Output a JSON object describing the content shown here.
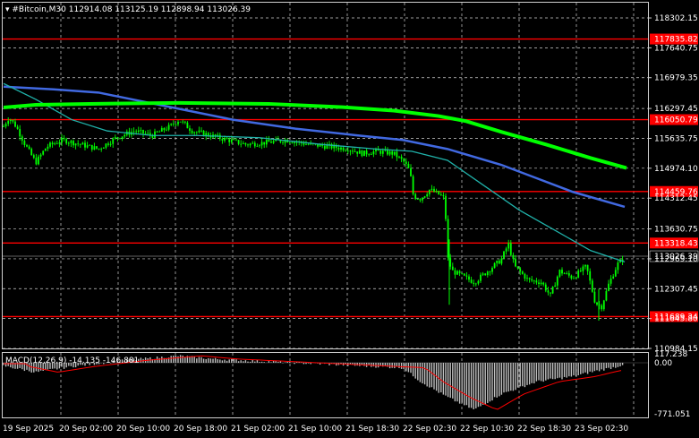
{
  "header": {
    "symbol": "#Bitcoin,M30",
    "ohlc": "112914.08 113125.19 112898.94 113026.39"
  },
  "price_axis": {
    "labels": [
      "118302.15",
      "117640.75",
      "116979.35",
      "116297.45",
      "115635.75",
      "114974.10",
      "114312.45",
      "113630.75",
      "112969.10",
      "112307.45",
      "111645.80",
      "110984.15"
    ],
    "current_price": "113026.39",
    "current_price_color": "#ffffff"
  },
  "horizontal_lines": [
    {
      "value": "117835.82",
      "color": "#ff0000"
    },
    {
      "value": "116050.79",
      "color": "#ff0000"
    },
    {
      "value": "114459.76",
      "color": "#ff0000"
    },
    {
      "value": "113318.43",
      "color": "#ff0000"
    },
    {
      "value": "111689.34",
      "color": "#ff0000"
    }
  ],
  "time_axis": {
    "labels": [
      "19 Sep 2025",
      "20 Sep 02:00",
      "20 Sep 10:00",
      "20 Sep 18:00",
      "21 Sep 02:00",
      "21 Sep 10:00",
      "21 Sep 18:30",
      "22 Sep 02:30",
      "22 Sep 10:30",
      "22 Sep 18:30",
      "23 Sep 02:30"
    ]
  },
  "macd": {
    "label": "MACD(12,26,9) -14.135 -146.881",
    "axis_labels": [
      "117.238",
      "0.00",
      "-771.051"
    ]
  },
  "colors": {
    "background": "#000000",
    "grid": "#d0d0d0",
    "candle": "#00ff00",
    "ma_slow": "#00ff00",
    "ma_mid": "#4169e1",
    "ma_fast": "#20b2aa",
    "level_line": "#ff0000",
    "macd_hist": "#c0c0c0",
    "macd_signal": "#ff0000"
  },
  "chart_data": {
    "type": "line",
    "title": "#Bitcoin,M30",
    "x": [
      "19 Sep 2025",
      "20 Sep 02:00",
      "20 Sep 10:00",
      "20 Sep 18:00",
      "21 Sep 02:00",
      "21 Sep 10:00",
      "21 Sep 18:30",
      "22 Sep 02:30",
      "22 Sep 10:30",
      "22 Sep 18:30",
      "23 Sep 02:30"
    ],
    "series": [
      {
        "values": [
          116050,
          115900,
          115640,
          115980,
          115640,
          115520,
          115250,
          113200,
          112900,
          112600,
          113026
        ]
      },
      {
        "values": [
          116297,
          116270,
          116297,
          116297,
          116200,
          116100,
          115950,
          115700,
          115300,
          114900,
          114974
        ]
      },
      {
        "values": [
          116800,
          116700,
          116500,
          116100,
          115800,
          115600,
          115400,
          114700,
          114300,
          113900,
          113700
        ]
      },
      {
        "values": [
          116900,
          116200,
          115640,
          115640,
          115600,
          115500,
          115300,
          114500,
          113600,
          113000,
          112800
        ]
      }
    ],
    "ylim": [
      110984.15,
      118640
    ]
  }
}
